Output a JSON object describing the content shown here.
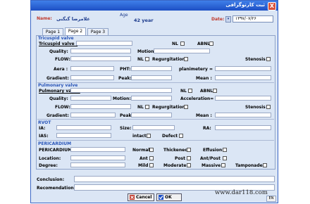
{
  "window": {
    "title": "ثبت کارتوگرافی",
    "close": "X"
  },
  "header": {
    "name_label": "Name:",
    "name_value": "غلامرضا گنگنی",
    "age_label": "Age",
    "age_value": "42 year",
    "date_label": "Date:",
    "date_value": "۱۳۹۷/۰۷/۲۶",
    "date_dropdown": "▾"
  },
  "tabs": [
    "Page 1",
    "Page 2",
    "Page 3"
  ],
  "tricuspid": {
    "section": "Tricuspid valve",
    "valve_label": "Tricuspid valve :",
    "nl": "NL",
    "abnl": "ABNL",
    "quality": "Quality:",
    "motion": "Motion:",
    "flow": "FLOW:",
    "regurgitation": "Regurgitation",
    "stenosis": "Stenosis",
    "area": "Aera :",
    "pht": "PHT:",
    "planimetery": "planimetery =",
    "gradient": "Gradient:",
    "peak": "Peak:",
    "mean": "Mean :"
  },
  "pulmonary": {
    "section": "Pulmonary valve",
    "valve_label": "Pulmonary valve:",
    "nl": "NL",
    "abnl": "ABNL",
    "quality": "Quality:",
    "motion": "Motion:",
    "acceleration": "Acceleration=",
    "flow": "FLOW:",
    "regurgitation": "Regurgitation",
    "stenosis": "Stenosis",
    "gradient": "Gradient:",
    "peak": "Peak",
    "mean": "Mean :"
  },
  "rvot": {
    "section": "RVOT",
    "ia": "IA:",
    "size": "Size:",
    "ra": "RA:",
    "ias": "IAS:",
    "intact": "intact",
    "defect": "Defect"
  },
  "pericardium": {
    "section": "PERICARDIUM",
    "label": "PERICARDIUM:",
    "location": "Location:",
    "degree": "Degree:",
    "normal": "Normal",
    "thickened": "Thickened",
    "effusion": "Effusion",
    "ant": "Ant",
    "post": "Post",
    "ant_post": "Ant/Post",
    "mild": "Mild",
    "moderate": "Moderate",
    "massive": "Massive",
    "tamponade": "Tamponade"
  },
  "footer": {
    "conclusion": "Conclusion:",
    "recomendation": "Recomendation:",
    "cancel": "Cancel",
    "ok": "OK",
    "lang": "EN"
  },
  "watermark": "www.dar118.com"
}
